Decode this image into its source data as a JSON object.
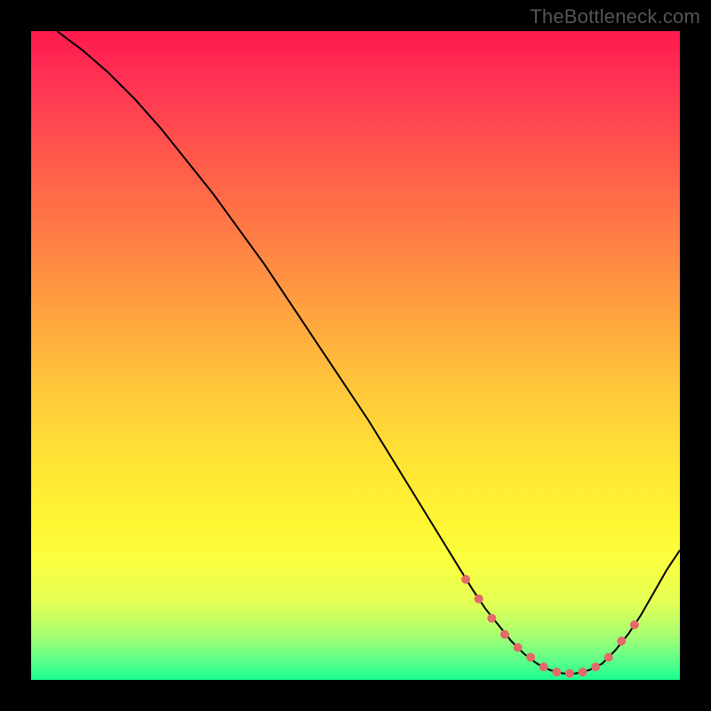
{
  "watermark": "TheBottleneck.com",
  "chart_data": {
    "type": "line",
    "title": "",
    "xlabel": "",
    "ylabel": "",
    "xlim": [
      0,
      100
    ],
    "ylim": [
      0,
      100
    ],
    "grid": false,
    "legend": false,
    "series": [
      {
        "name": "bottleneck-curve",
        "x": [
          4,
          8,
          12,
          16,
          20,
          24,
          28,
          32,
          36,
          40,
          44,
          48,
          52,
          56,
          60,
          64,
          68,
          70,
          72,
          74,
          76,
          78,
          80,
          82,
          84,
          86,
          88,
          90,
          92,
          94,
          96,
          98,
          100
        ],
        "values": [
          100,
          97,
          93.5,
          89.5,
          85,
          80,
          75,
          69.5,
          64,
          58,
          52,
          46,
          40,
          33.5,
          27,
          20.5,
          14,
          11,
          8.5,
          6,
          4,
          2.5,
          1.5,
          1,
          1,
          1.5,
          2.5,
          4.5,
          7,
          10,
          13.5,
          17,
          20
        ]
      }
    ],
    "markers": {
      "name": "highlighted-points",
      "x": [
        67,
        69,
        71,
        73,
        75,
        77,
        79,
        81,
        83,
        85,
        87,
        89,
        91,
        93
      ],
      "values": [
        15.5,
        12.5,
        9.5,
        7,
        5,
        3.5,
        2,
        1.2,
        1,
        1.2,
        2,
        3.5,
        6,
        8.5
      ]
    }
  }
}
